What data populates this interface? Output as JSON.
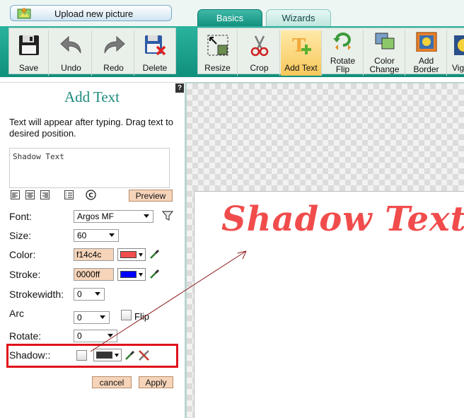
{
  "top": {
    "upload_label": "Upload new picture",
    "tabs": [
      {
        "label": "Basics",
        "active": true
      },
      {
        "label": "Wizards",
        "active": false
      }
    ]
  },
  "toolbar": {
    "left": [
      {
        "label": "Save"
      },
      {
        "label": "Undo"
      },
      {
        "label": "Redo"
      },
      {
        "label": "Delete"
      }
    ],
    "right": [
      {
        "label": "Resize"
      },
      {
        "label": "Crop"
      },
      {
        "label": "Add Text",
        "active": true
      },
      {
        "label": "Rotate Flip"
      },
      {
        "label": "Color Change"
      },
      {
        "label": "Add Border"
      },
      {
        "label": "Vig"
      }
    ]
  },
  "panel": {
    "title": "Add Text",
    "hint": "Text will appear after typing. Drag text to desired position.",
    "text_value": "Shadow Text",
    "preview_label": "Preview",
    "fields": {
      "font_label": "Font:",
      "font_value": "Argos MF",
      "size_label": "Size:",
      "size_value": "60",
      "color_label": "Color:",
      "color_hex": "f14c4c",
      "stroke_label": "Stroke:",
      "stroke_hex": "0000ff",
      "strokewidth_label": "Strokewidth:",
      "strokewidth_value": "0",
      "arc_label": "Arc",
      "arc_value": "0",
      "flip_label": "Flip",
      "rotate_label": "Rotate:",
      "rotate_value": "0",
      "shadow_label": "Shadow::"
    },
    "cancel_label": "cancel",
    "apply_label": "Apply"
  },
  "canvas": {
    "text": "Shadow Text"
  },
  "colors": {
    "text_color": "#f14c4c",
    "stroke_color": "#0000ff",
    "shadow_color": "#333333",
    "highlight": "#e0121b",
    "accent": "#1b8a7c"
  }
}
